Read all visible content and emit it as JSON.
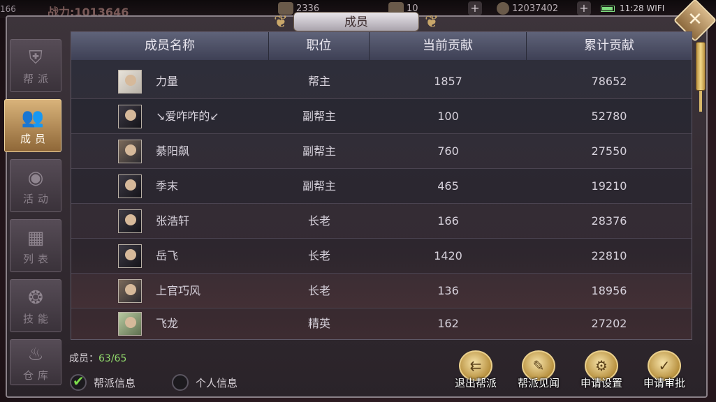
{
  "status_bar": {
    "left_number": "166",
    "power_text": "战力:1013646",
    "res1": "2336",
    "res2": "10",
    "res3": "12037402",
    "time": "11:28",
    "wifi": "WIFI"
  },
  "window": {
    "title": "成员"
  },
  "side_tabs": [
    {
      "label": "帮派",
      "icon": "guild-emblem-icon",
      "active": false
    },
    {
      "label": "成员",
      "icon": "members-icon",
      "active": true
    },
    {
      "label": "活动",
      "icon": "activity-icon",
      "active": false
    },
    {
      "label": "列表",
      "icon": "list-icon",
      "active": false
    },
    {
      "label": "技能",
      "icon": "skill-icon",
      "active": false
    },
    {
      "label": "仓库",
      "icon": "warehouse-icon",
      "active": false
    }
  ],
  "table": {
    "headers": [
      "成员名称",
      "职位",
      "当前贡献",
      "累计贡献"
    ],
    "rows": [
      {
        "name": "力量",
        "role": "帮主",
        "current": "1857",
        "total": "78652"
      },
      {
        "name": "↘爱咋咋的↙",
        "role": "副帮主",
        "current": "100",
        "total": "52780"
      },
      {
        "name": "綦阳飙",
        "role": "副帮主",
        "current": "760",
        "total": "27550"
      },
      {
        "name": "季末",
        "role": "副帮主",
        "current": "465",
        "total": "19210"
      },
      {
        "name": "张浩轩",
        "role": "长老",
        "current": "166",
        "total": "28376"
      },
      {
        "name": "岳飞",
        "role": "长老",
        "current": "1420",
        "total": "22810"
      },
      {
        "name": "上官巧风",
        "role": "长老",
        "current": "136",
        "total": "18956"
      },
      {
        "name": "飞龙",
        "role": "精英",
        "current": "162",
        "total": "27202"
      }
    ]
  },
  "footer": {
    "member_label": "成员：",
    "member_count": "63/65",
    "radio_guild": "帮派信息",
    "radio_personal": "个人信息",
    "actions": [
      "退出帮派",
      "帮派见闻",
      "申请设置",
      "申请审批"
    ]
  }
}
